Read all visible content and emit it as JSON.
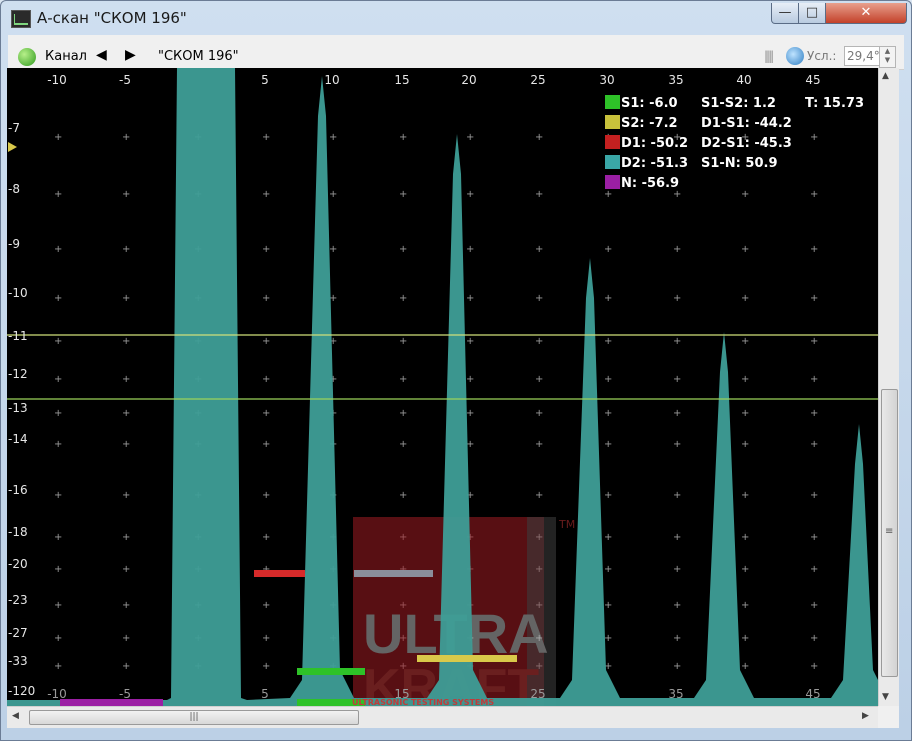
{
  "window": {
    "title": "А-скан \"СКОМ 196\"",
    "icon": "ascan-app-icon",
    "controls": {
      "minimize": "—",
      "maximize": "□",
      "close": "✕"
    }
  },
  "toolbar": {
    "channel_label": "Канал",
    "prev_icon": "arrow-left-icon",
    "next_icon": "arrow-right-icon",
    "channel_name": "\"СКОМ 196\"",
    "gain_label": "Усл.:",
    "gain_value": "29,4°"
  },
  "scope": {
    "x_ticks_top": [
      "-10",
      "-5",
      "5",
      "10",
      "15",
      "20",
      "25",
      "30",
      "35",
      "40",
      "45"
    ],
    "x_ticks_bottom": [
      "-10",
      "-5",
      "5",
      "15",
      "25",
      "35",
      "45"
    ],
    "y_ticks": [
      "-7",
      "-8",
      "-9",
      "-10",
      "-11",
      "-12",
      "-13",
      "-14",
      "-16",
      "-18",
      "-20",
      "-23",
      "-27",
      "-33",
      "-120"
    ],
    "colors": {
      "background": "#000000",
      "signal": "#3e9e97",
      "gate1": "#2ec228",
      "gate2": "#c8c23b",
      "d1": "#c42020",
      "d2": "#3aa7a6",
      "noise": "#9b1fa4",
      "threshold": "#cfe07a"
    },
    "legend": [
      {
        "swatch": "#2ec228",
        "text": "S1: -6.0"
      },
      {
        "swatch": "#c8c23b",
        "text": "S2: -7.2"
      },
      {
        "swatch": "#c42020",
        "text": "D1: -50.2"
      },
      {
        "swatch": "#3aa7a6",
        "text": "D2: -51.3"
      },
      {
        "swatch": "#9b1fa4",
        "text": "N: -56.9"
      }
    ],
    "legend_diffs": [
      "S1-S2: 1.2",
      "D1-S1: -44.2",
      "D2-S1: -45.3",
      "S1-N: 50.9"
    ],
    "t_value": "T: 15.73",
    "watermark": {
      "tm": "TM",
      "line1": "ULTRA",
      "line2": "KRAFT",
      "tagline": "ULTRASONIC TESTING SYSTEMS"
    }
  },
  "scrollbar": {
    "grip": "|||",
    "grip_v": "≡"
  }
}
